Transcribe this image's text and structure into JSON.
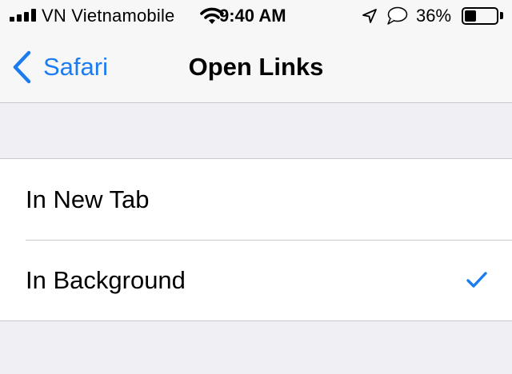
{
  "status_bar": {
    "carrier": "VN Vietnamobile",
    "time": "9:40 AM",
    "battery_percent_label": "36%",
    "battery_level": 0.36,
    "signal_bars": 4,
    "icons": [
      "signal-icon",
      "wifi-icon",
      "location-arrow-icon",
      "speech-bubble-icon",
      "battery-icon"
    ]
  },
  "nav": {
    "back_label": "Safari",
    "back_icon": "chevron-left-icon",
    "title": "Open Links"
  },
  "options": [
    {
      "label": "In New Tab",
      "selected": false
    },
    {
      "label": "In Background",
      "selected": true
    }
  ],
  "colors": {
    "accent": "#1b7cf2",
    "background": "#efeff4",
    "bar_background": "#f7f7f7",
    "separator": "#c8c7cc"
  }
}
